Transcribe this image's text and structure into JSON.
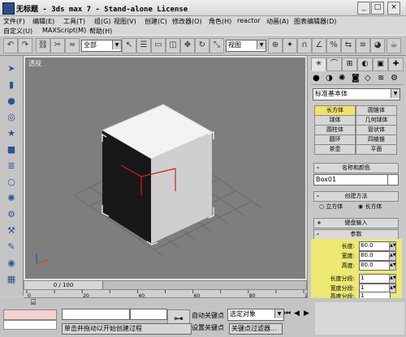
{
  "window": {
    "title": "无标题  - 3ds max 7  - Stand-alone License",
    "buttons": [
      "_",
      "□",
      "×"
    ]
  },
  "menu": {
    "items": [
      "文件(F)",
      "编辑(E)",
      "工具(T)",
      "组(G)",
      "视图(V)",
      "创建(C)",
      "修改器(O)",
      "角色(H)",
      "reactor",
      "动画(A)",
      "图表编辑器(D)"
    ],
    "items2": [
      "自定义(U)",
      "MAXScript(M)",
      "帮助(H)"
    ]
  },
  "toolbar": {
    "filter_value": "全部",
    "viewcoord_value": "视图"
  },
  "viewport": {
    "label": "透视"
  },
  "timeline": {
    "frame_text": "0 / 100",
    "ruler_ticks": [
      "0",
      "10",
      "20",
      "30",
      "40",
      "50",
      "60",
      "70",
      "80",
      "90",
      "100"
    ]
  },
  "panel": {
    "category_dropdown": "标准基本体",
    "object_buttons": [
      "长方体",
      "圆锥体",
      "球体",
      "几何球体",
      "圆柱体",
      "管状体",
      "圆环",
      "四棱锥",
      "茶壶",
      "平面"
    ],
    "name_color_header": "名称和颜色",
    "object_name": "Box01",
    "creation_method_header": "创建方法",
    "creation_options": [
      "立方体",
      "长方体"
    ],
    "keyboard_entry_header": "键盘输入",
    "params_header": "参数",
    "params": [
      {
        "label": "长度:",
        "value": "80.0"
      },
      {
        "label": "宽度:",
        "value": "80.0"
      },
      {
        "label": "高度:",
        "value": "80.0"
      },
      {
        "label": "长度分段:",
        "value": "1"
      },
      {
        "label": "宽度分段:",
        "value": "1"
      },
      {
        "label": "高度分段:",
        "value": "1"
      }
    ]
  },
  "status": {
    "prompt": "单击并拖动以开始创建过程",
    "auto_key": "自动关键点",
    "set_key": "设置关键点",
    "selection_dropdown": "选定对象",
    "key_filters": "关键点过滤器..."
  },
  "colors": {
    "highlight": "#f1e36a",
    "viewport_bg": "#7e7e7e"
  }
}
